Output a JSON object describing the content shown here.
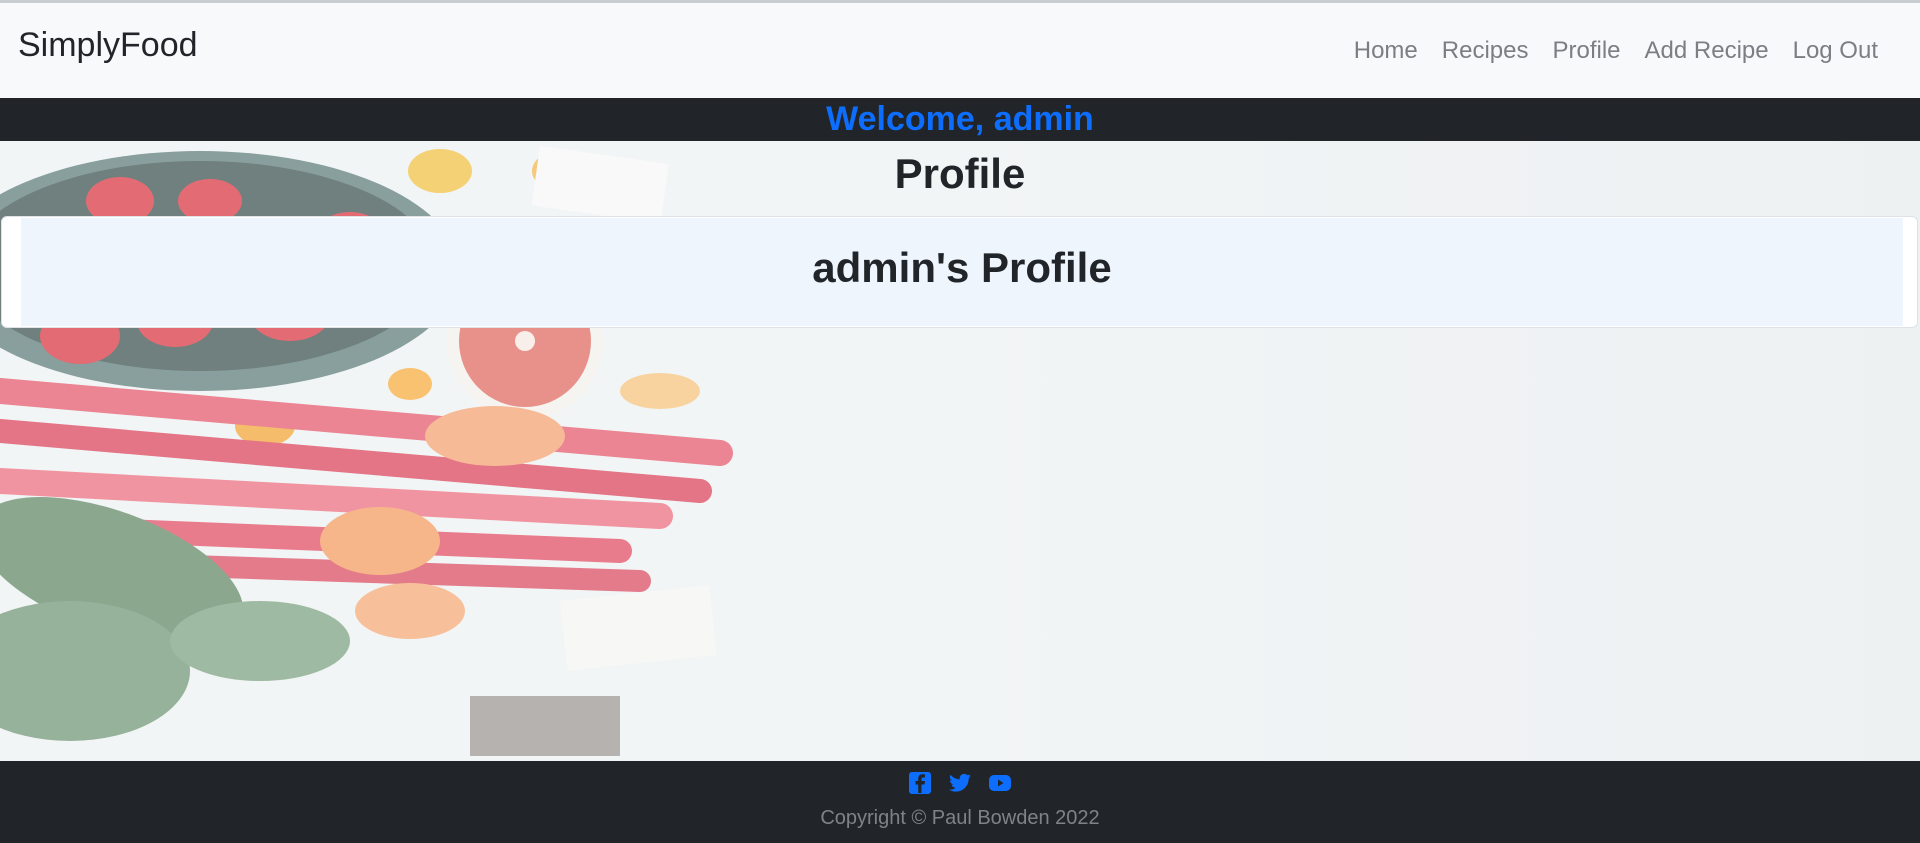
{
  "brand": "SimplyFood",
  "nav": {
    "home": "Home",
    "recipes": "Recipes",
    "profile": "Profile",
    "add_recipe": "Add Recipe",
    "logout": "Log Out"
  },
  "welcome": "Welcome, admin",
  "page_title": "Profile",
  "profile_card": {
    "title": "admin's Profile"
  },
  "footer": {
    "social_icons": [
      "facebook-icon",
      "twitter-icon",
      "youtube-icon"
    ],
    "copyright": "Copyright © Paul Bowden 2022"
  },
  "colors": {
    "accent": "#0d6efd",
    "dark": "#212529",
    "navbar_bg": "#f8f9fa",
    "card_bg": "#eef5fd"
  }
}
